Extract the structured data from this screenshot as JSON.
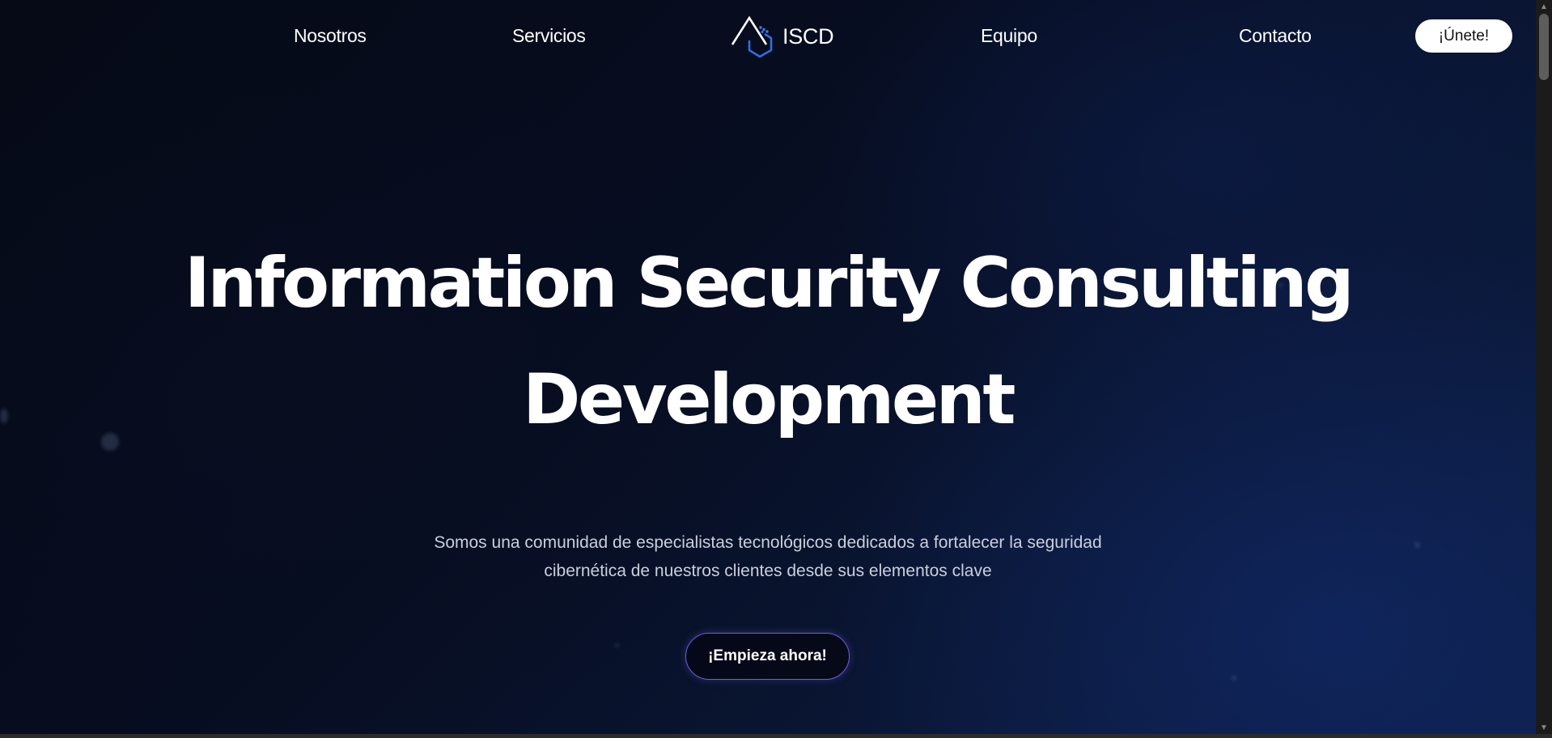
{
  "nav": {
    "links": [
      {
        "label": "Nosotros"
      },
      {
        "label": "Servicios"
      },
      {
        "label": "Equipo"
      },
      {
        "label": "Contacto"
      }
    ],
    "brand": "ISCD",
    "join_label": "¡Únete!"
  },
  "hero": {
    "title_line1": "Information Security Consulting",
    "title_line2": "Development",
    "subtitle_line1": "Somos una comunidad de especialistas tecnológicos dedicados a fortalecer la seguridad",
    "subtitle_line2": "cibernética de nuestros clientes desde sus elementos clave",
    "cta_label": "¡Empieza ahora!"
  },
  "icons": {
    "brand_logo": "iscd-logo-icon",
    "scroll_up": "arrow-up-icon",
    "scroll_down": "arrow-down-icon"
  },
  "colors": {
    "background": "#060a16",
    "background_accent": "#0d1f48",
    "cta_border": "#6c5fd6",
    "logo_blue": "#2f6fe0",
    "join_button_bg": "#ffffff"
  }
}
